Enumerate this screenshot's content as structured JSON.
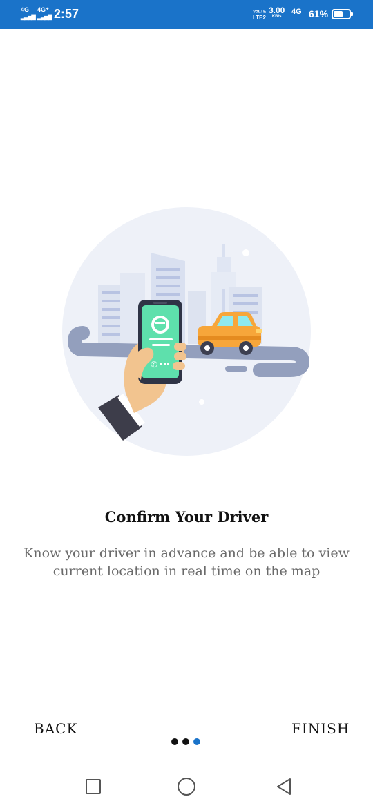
{
  "status_bar": {
    "sim1": "4G",
    "sim2": "4G⁺",
    "time": "2:57",
    "volte": "VoLTE",
    "volte_sub": "LTE2",
    "speed": "3.00",
    "speed_unit": "KB/s",
    "net_type": "4G",
    "battery_percent": "61%",
    "battery_level": 0.61
  },
  "onboarding": {
    "illustration_icon": "phone-driver-car-illustration",
    "title": "Confirm Your Driver",
    "description": "Know your driver in advance and be able to view current location in real time on the map",
    "page_index": 3,
    "page_count": 3
  },
  "navigation": {
    "back_label": "BACK",
    "finish_label": "FINISH"
  },
  "colors": {
    "status_bar": "#1a73c9",
    "accent": "#1a73c9",
    "phone_screen": "#5ee0ac",
    "car": "#f7a63a"
  }
}
